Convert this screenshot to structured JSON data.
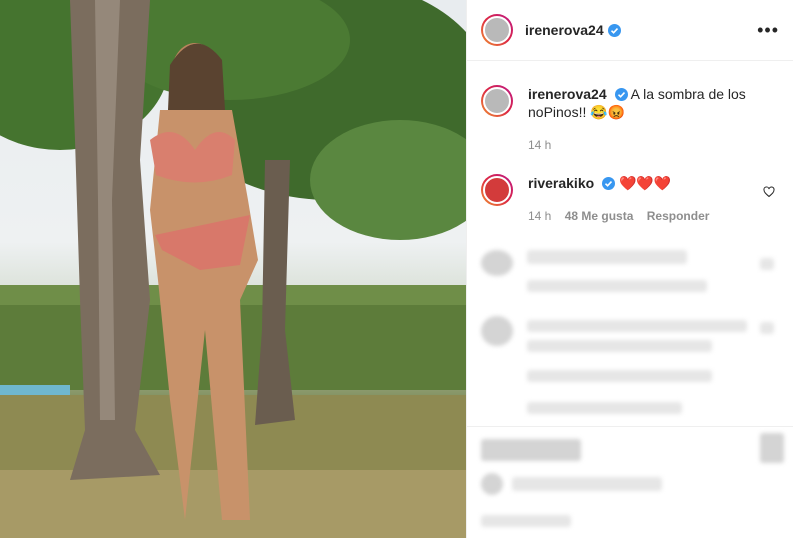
{
  "post": {
    "username": "irenerova24",
    "caption": "A la sombra de los noPinos!! 😂😡",
    "caption_time": "14 h"
  },
  "comment": {
    "username": "riverakiko",
    "text": "❤️❤️❤️",
    "time": "14 h",
    "likes": "48 Me gusta",
    "reply": "Responder"
  },
  "icons": [
    "verified-icon",
    "more-options-icon",
    "heart-icon"
  ],
  "colors": {
    "verified": "#3897f0",
    "heart": "#ed4956",
    "meta": "#8e8e8e"
  }
}
